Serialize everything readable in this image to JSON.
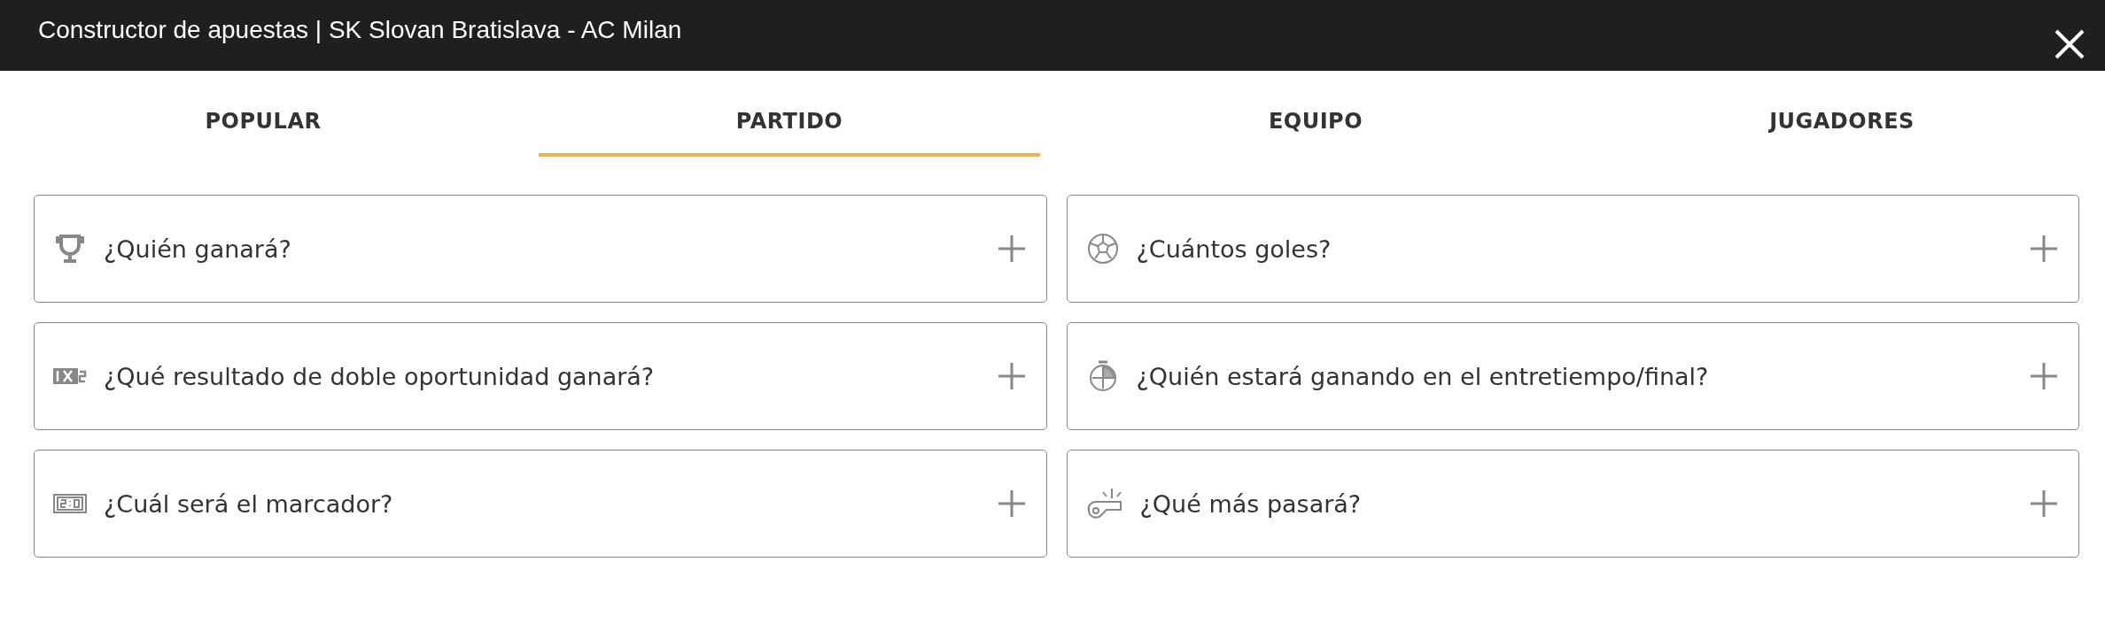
{
  "window": {
    "title": "Constructor de apuestas | SK Slovan Bratislava - AC Milan"
  },
  "tabs": [
    {
      "label": "POPULAR",
      "selected": false
    },
    {
      "label": "PARTIDO",
      "selected": true
    },
    {
      "label": "EQUIPO",
      "selected": false
    },
    {
      "label": "JUGADORES",
      "selected": false
    }
  ],
  "markets": [
    {
      "kind": "trophy",
      "label": "¿Quién ganará?"
    },
    {
      "kind": "ball",
      "label": "¿Cuántos goles?"
    },
    {
      "kind": "double",
      "label": "¿Qué resultado de doble oportunidad ganará?"
    },
    {
      "kind": "stopwatch",
      "label": "¿Quién estará ganando en el entretiempo/final?"
    },
    {
      "kind": "scoreboard",
      "label": "¿Cuál será el marcador?"
    },
    {
      "kind": "whistle",
      "label": "¿Qué más pasará?"
    }
  ]
}
